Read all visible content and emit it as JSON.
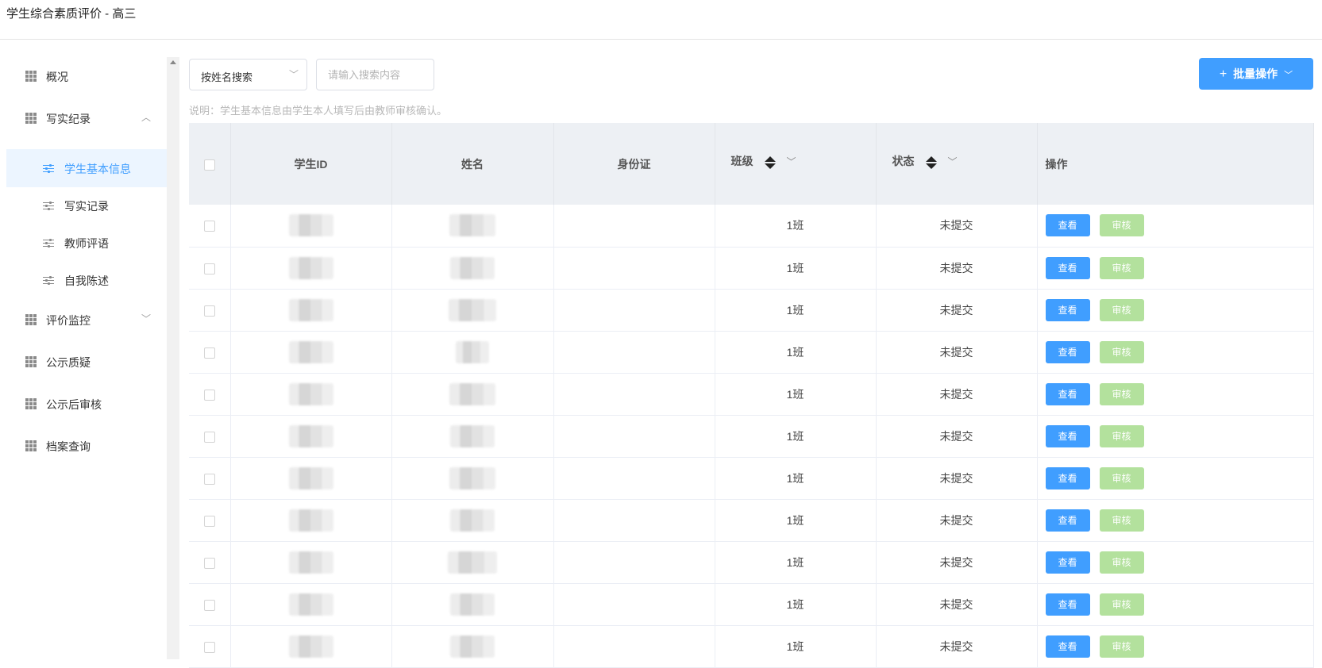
{
  "header": {
    "title": "学生综合素质评价 - 高三"
  },
  "sidebar": {
    "items": [
      {
        "label": "概况",
        "icon": "grid-icon",
        "type": "top"
      },
      {
        "label": "写实纪录",
        "icon": "grid-icon",
        "type": "top",
        "expanded": true,
        "chevron": "︿"
      },
      {
        "label": "学生基本信息",
        "icon": "sliders-icon",
        "type": "sub",
        "active": true
      },
      {
        "label": "写实记录",
        "icon": "sliders-icon",
        "type": "sub"
      },
      {
        "label": "教师评语",
        "icon": "sliders-icon",
        "type": "sub"
      },
      {
        "label": "自我陈述",
        "icon": "sliders-icon",
        "type": "sub"
      },
      {
        "label": "评价监控",
        "icon": "grid-icon",
        "type": "top",
        "chevron": "﹀"
      },
      {
        "label": "公示质疑",
        "icon": "grid-icon",
        "type": "top"
      },
      {
        "label": "公示后审核",
        "icon": "grid-icon",
        "type": "top"
      },
      {
        "label": "档案查询",
        "icon": "grid-icon",
        "type": "top"
      }
    ]
  },
  "toolbar": {
    "search_mode": "按姓名搜索",
    "search_placeholder": "请输入搜索内容",
    "batch_label": "批量操作",
    "note": "说明：学生基本信息由学生本人填写后由教师审核确认。"
  },
  "table": {
    "columns": [
      "学生ID",
      "姓名",
      "身份证",
      "班级",
      "状态",
      "操作"
    ],
    "view_label": "查看",
    "audit_label": "审核",
    "rows": [
      {
        "class": "1班",
        "status": "未提交"
      },
      {
        "class": "1班",
        "status": "未提交"
      },
      {
        "class": "1班",
        "status": "未提交"
      },
      {
        "class": "1班",
        "status": "未提交"
      },
      {
        "class": "1班",
        "status": "未提交"
      },
      {
        "class": "1班",
        "status": "未提交"
      },
      {
        "class": "1班",
        "status": "未提交"
      },
      {
        "class": "1班",
        "status": "未提交"
      },
      {
        "class": "1班",
        "status": "未提交"
      },
      {
        "class": "1班",
        "status": "未提交"
      },
      {
        "class": "1班",
        "status": "未提交"
      }
    ]
  },
  "colors": {
    "primary": "#409eff",
    "audit_disabled": "#b3e19d",
    "active_bg": "#ecf5ff",
    "header_bg": "#edf0f4"
  }
}
